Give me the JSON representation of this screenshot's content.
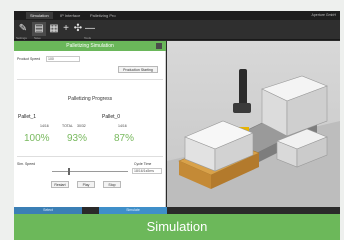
{
  "tabs": [
    "Simulation",
    "IP Interface",
    "Palletizing Pro"
  ],
  "title_right": "Aperture GmbH",
  "toolbar": {
    "tools": [
      {
        "icon": "pen-icon",
        "caption": "Settings"
      },
      {
        "icon": "save-icon",
        "caption": "Save"
      },
      {
        "icon": "grid-icon",
        "caption": ""
      },
      {
        "icon": "plus-icon",
        "caption": ""
      },
      {
        "icon": "move-icon",
        "caption": ""
      },
      {
        "icon": "minus-icon",
        "caption": ""
      }
    ],
    "group_caption": "Tools"
  },
  "panel": {
    "title": "Palletizing Simulation",
    "product_speed_label": "Product Speed",
    "product_speed_value": "100",
    "product_button": "Production Starting",
    "progress_title": "Palletizing Progress",
    "pallets": [
      {
        "name": "Pallet_1",
        "count": "14/16",
        "percent": "100%"
      },
      {
        "name": "TOTAL",
        "count": "30/32",
        "percent": "93%"
      },
      {
        "name": "Pallet_0",
        "count": "14/16",
        "percent": "87%"
      }
    ],
    "sim_speed_label": "Sim. Speed",
    "cycle_time_label": "Cycle Time",
    "cycle_time_value": "18/16/1s5ms",
    "buttons": [
      "Restart",
      "Play",
      "Stop"
    ]
  },
  "bottom_actions": [
    "Select",
    "Simulate"
  ],
  "caption": "Simulation",
  "colors": {
    "accent": "#6cb85a",
    "percent": "#78b95e",
    "action": "#3f8fc9"
  }
}
